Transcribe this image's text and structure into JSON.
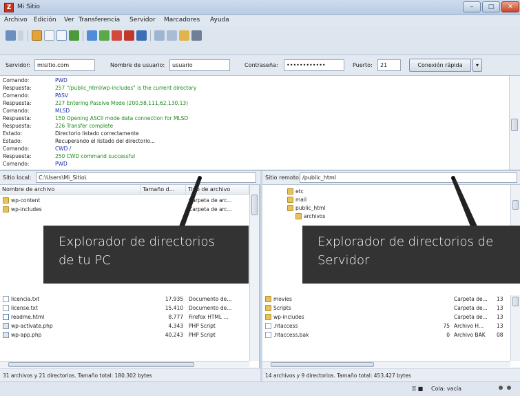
{
  "window": {
    "title": "Mi Sitio",
    "app_icon": "filezilla-icon"
  },
  "menu": [
    "Archivo",
    "Edición",
    "Ver",
    "Transferencia",
    "Servidor",
    "Marcadores",
    "Ayuda"
  ],
  "quickconnect": {
    "server_label": "Servidor:",
    "server_value": "misitio.com",
    "user_label": "Nombre de usuario:",
    "user_value": "usuario",
    "pass_label": "Contraseña:",
    "pass_value": "••••••••••••",
    "port_label": "Puerto:",
    "port_value": "21",
    "connect_label": "Conexión rápida"
  },
  "log": [
    {
      "type": "Comando:",
      "msg": "PWD",
      "color": "#1a2fb0"
    },
    {
      "type": "Respuesta:",
      "msg": "257 \"/public_html/wp-includes\" is the current directory",
      "color": "#1f8a1f"
    },
    {
      "type": "Comando:",
      "msg": "PASV",
      "color": "#1a2fb0"
    },
    {
      "type": "Respuesta:",
      "msg": "227 Entering Passive Mode (200,58,111,62,130,13)",
      "color": "#1f8a1f"
    },
    {
      "type": "Comando:",
      "msg": "MLSD",
      "color": "#1a2fb0"
    },
    {
      "type": "Respuesta:",
      "msg": "150 Opening ASCII mode data connection for MLSD",
      "color": "#1f8a1f"
    },
    {
      "type": "Respuesta:",
      "msg": "226 Transfer complete",
      "color": "#1f8a1f"
    },
    {
      "type": "Estado:",
      "msg": "Directorio listado correctamente",
      "color": "#222222"
    },
    {
      "type": "Estado:",
      "msg": "Recuperando el listado del directorio...",
      "color": "#222222"
    },
    {
      "type": "Comando:",
      "msg": "CWD /",
      "color": "#1a2fb0"
    },
    {
      "type": "Respuesta:",
      "msg": "250 CWD command successful",
      "color": "#1f8a1f"
    },
    {
      "type": "Comando:",
      "msg": "PWD",
      "color": "#1a2fb0"
    }
  ],
  "local": {
    "path_label": "Sitio local:",
    "path_value": "C:\\Users\\Mi_Sitio\\",
    "col_name": "Nombre de archivo",
    "col_size": "Tamaño d...",
    "col_type": "Tipo de archivo",
    "files": [
      {
        "name": "wp-content",
        "size": "",
        "type": "Carpeta de arc...",
        "icon": "folder"
      },
      {
        "name": "wp-includes",
        "size": "",
        "type": "Carpeta de arc...",
        "icon": "folder"
      },
      {
        "name": "licencia.txt",
        "size": "17.935",
        "type": "Documento de...",
        "icon": "file"
      },
      {
        "name": "license.txt",
        "size": "15.410",
        "type": "Documento de...",
        "icon": "file"
      },
      {
        "name": "readme.html",
        "size": "8.777",
        "type": "Firefox HTML ...",
        "icon": "html"
      },
      {
        "name": "wp-activate.php",
        "size": "4.343",
        "type": "PHP Script",
        "icon": "php"
      },
      {
        "name": "wp-app.php",
        "size": "40.243",
        "type": "PHP Script",
        "icon": "php"
      }
    ],
    "status": "31 archivos y 21 directorios. Tamaño total: 180.302 bytes"
  },
  "remote": {
    "path_label": "Sitio remoto:",
    "path_value": "/public_html",
    "tree": [
      "etc",
      "mail",
      "public_html",
      "archivos"
    ],
    "files": [
      {
        "name": "movies",
        "size": "",
        "type": "Carpeta de...",
        "perm": "13",
        "icon": "folder"
      },
      {
        "name": "Scripts",
        "size": "",
        "type": "Carpeta de...",
        "perm": "13",
        "icon": "folder"
      },
      {
        "name": "wp-includes",
        "size": "",
        "type": "Carpeta de...",
        "perm": "13",
        "icon": "folder"
      },
      {
        "name": ".htaccess",
        "size": "75",
        "type": "Archivo H...",
        "perm": "13",
        "icon": "file"
      },
      {
        "name": ".htaccess.bak",
        "size": "0",
        "type": "Archivo BAK",
        "perm": "08",
        "icon": "file"
      }
    ],
    "status": "14 archivos y 9 directorios. Tamaño total: 453.427 bytes"
  },
  "queue": {
    "label": "Cola: vacía"
  },
  "callouts": {
    "local": [
      "Explorador de directorios",
      "de tu PC"
    ],
    "remote": [
      "Explorador de directorios de",
      "Servidor"
    ]
  }
}
